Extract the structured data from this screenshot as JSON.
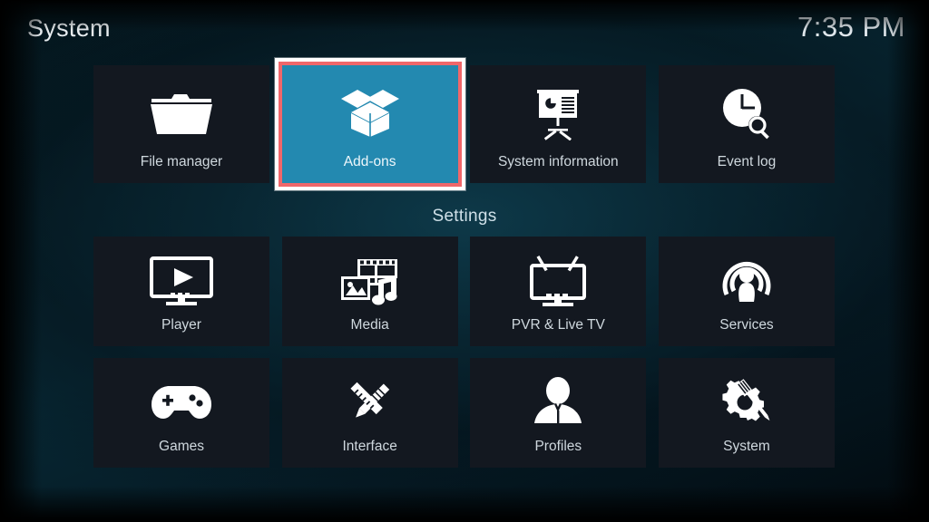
{
  "header": {
    "title": "System",
    "clock": "7:35 PM"
  },
  "colors": {
    "selected_tile": "#2389b0",
    "selection_border": "#f0676a",
    "selection_outer": "#ffffff",
    "tile_background": "#131820",
    "label_text": "#cfd8de"
  },
  "sections": {
    "settings_label": "Settings"
  },
  "top_row": [
    {
      "label": "File manager",
      "icon": "folder-icon",
      "selected": false
    },
    {
      "label": "Add-ons",
      "icon": "open-box-icon",
      "selected": true
    },
    {
      "label": "System information",
      "icon": "presentation-chart-icon",
      "selected": false
    },
    {
      "label": "Event log",
      "icon": "clock-search-icon",
      "selected": false
    }
  ],
  "settings_rows": [
    [
      {
        "label": "Player",
        "icon": "monitor-play-icon",
        "selected": false
      },
      {
        "label": "Media",
        "icon": "film-photo-music-icon",
        "selected": false
      },
      {
        "label": "PVR & Live TV",
        "icon": "tv-antenna-icon",
        "selected": false
      },
      {
        "label": "Services",
        "icon": "podcast-broadcast-icon",
        "selected": false
      }
    ],
    [
      {
        "label": "Games",
        "icon": "gamepad-icon",
        "selected": false
      },
      {
        "label": "Interface",
        "icon": "pencil-ruler-icon",
        "selected": false
      },
      {
        "label": "Profiles",
        "icon": "person-silhouette-icon",
        "selected": false
      },
      {
        "label": "System",
        "icon": "gears-screwdriver-icon",
        "selected": false
      }
    ]
  ]
}
